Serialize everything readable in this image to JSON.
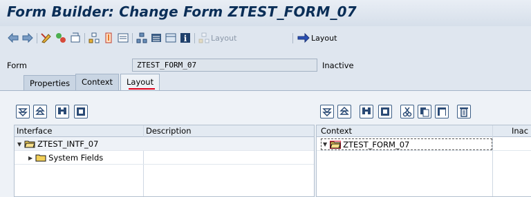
{
  "title": "Form Builder: Change Form ZTEST_FORM_07",
  "toolbar": {
    "layout_disabled_label": "Layout",
    "layout_active_label": "Layout"
  },
  "form": {
    "label": "Form",
    "value": "ZTEST_FORM_07",
    "status": "Inactive"
  },
  "tabs": [
    "Properties",
    "Context",
    "Layout"
  ],
  "left_grid": {
    "headers": [
      "Interface",
      "Description"
    ],
    "rows": [
      {
        "name": "ZTEST_INTF_07",
        "expanded": true
      },
      {
        "name": "System Fields",
        "expanded": false
      }
    ]
  },
  "right_grid": {
    "headers": [
      "Context",
      "Inac"
    ],
    "rows": [
      {
        "name": "ZTEST_FORM_07"
      }
    ]
  },
  "colors": {
    "title": "#0a2e57",
    "panel": "#eef2f7",
    "accent_red": "#e0001a",
    "folder": "#f2cf57"
  }
}
